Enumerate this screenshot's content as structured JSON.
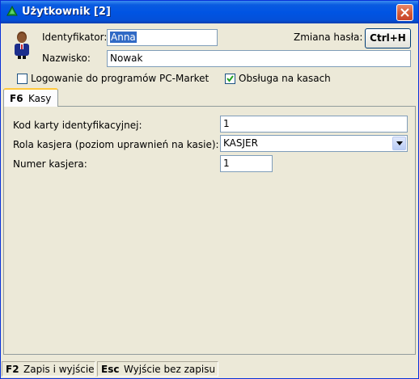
{
  "window": {
    "title": "Użytkownik [2]"
  },
  "user": {
    "id_label": "Identyfikator:",
    "id_value": "Anna",
    "name_label": "Nazwisko:",
    "name_value": "Nowak",
    "password_label": "Zmiana hasła:",
    "password_button": "Ctrl+H"
  },
  "options": {
    "login_pcmarket": {
      "label": "Logowanie do programów PC-Market",
      "checked": false
    },
    "cash_service": {
      "label": "Obsługa na kasach",
      "checked": true
    }
  },
  "tabs": [
    {
      "key": "F6",
      "label": "Kasy"
    }
  ],
  "kasy": {
    "card_label": "Kod karty identyfikacyjnej:",
    "card_value": "1",
    "role_label": "Rola kasjera (poziom uprawnień na kasie):",
    "role_value": "KASJER",
    "number_label": "Numer kasjera:",
    "number_value": "1"
  },
  "status": {
    "save": {
      "key": "F2",
      "label": "Zapis i wyjście"
    },
    "cancel": {
      "key": "Esc",
      "label": "Wyjście bez zapisu"
    }
  },
  "icons": {
    "app": "green-triangle-icon",
    "close": "close-icon",
    "user": "user-avatar-icon",
    "dropdown": "chevron-down-icon",
    "check": "checkmark-icon"
  }
}
